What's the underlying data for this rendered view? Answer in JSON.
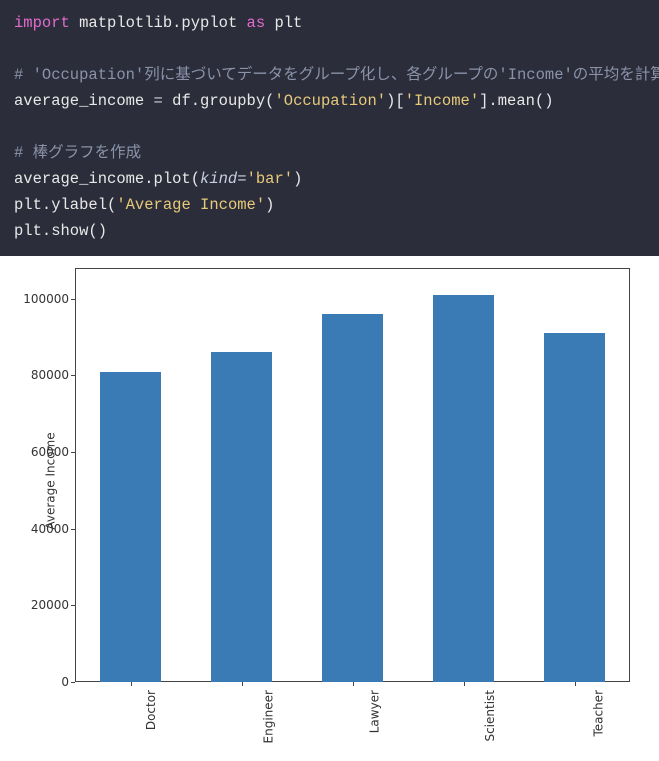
{
  "code": {
    "line1_import": "import",
    "line1_mod": " matplotlib.pyplot ",
    "line1_as": "as",
    "line1_alias": " plt",
    "line2_comment": "# 'Occupation'列に基づいてデータをグループ化し、各グループの'Income'の平均を計算",
    "line3_a": "average_income ",
    "line3_eq": "=",
    "line3_b": " df.groupby(",
    "line3_s1": "'Occupation'",
    "line3_c": ")[",
    "line3_s2": "'Income'",
    "line3_d": "].mean()",
    "line4_comment": "# 棒グラフを作成",
    "line5_a": "average_income.plot(",
    "line5_kind": "kind",
    "line5_eq": "=",
    "line5_s": "'bar'",
    "line5_b": ")",
    "line6_a": "plt.ylabel(",
    "line6_s": "'Average Income'",
    "line6_b": ")",
    "line7": "plt.show()"
  },
  "chart_data": {
    "type": "bar",
    "categories": [
      "Doctor",
      "Engineer",
      "Lawyer",
      "Scientist",
      "Teacher"
    ],
    "values": [
      81000,
      86000,
      96000,
      101000,
      91000
    ],
    "title": "",
    "xlabel": "",
    "ylabel": "Average Income",
    "ylim": [
      0,
      108000
    ],
    "yticks": [
      0,
      20000,
      40000,
      60000,
      80000,
      100000
    ],
    "bar_color": "#3a7ab5"
  }
}
